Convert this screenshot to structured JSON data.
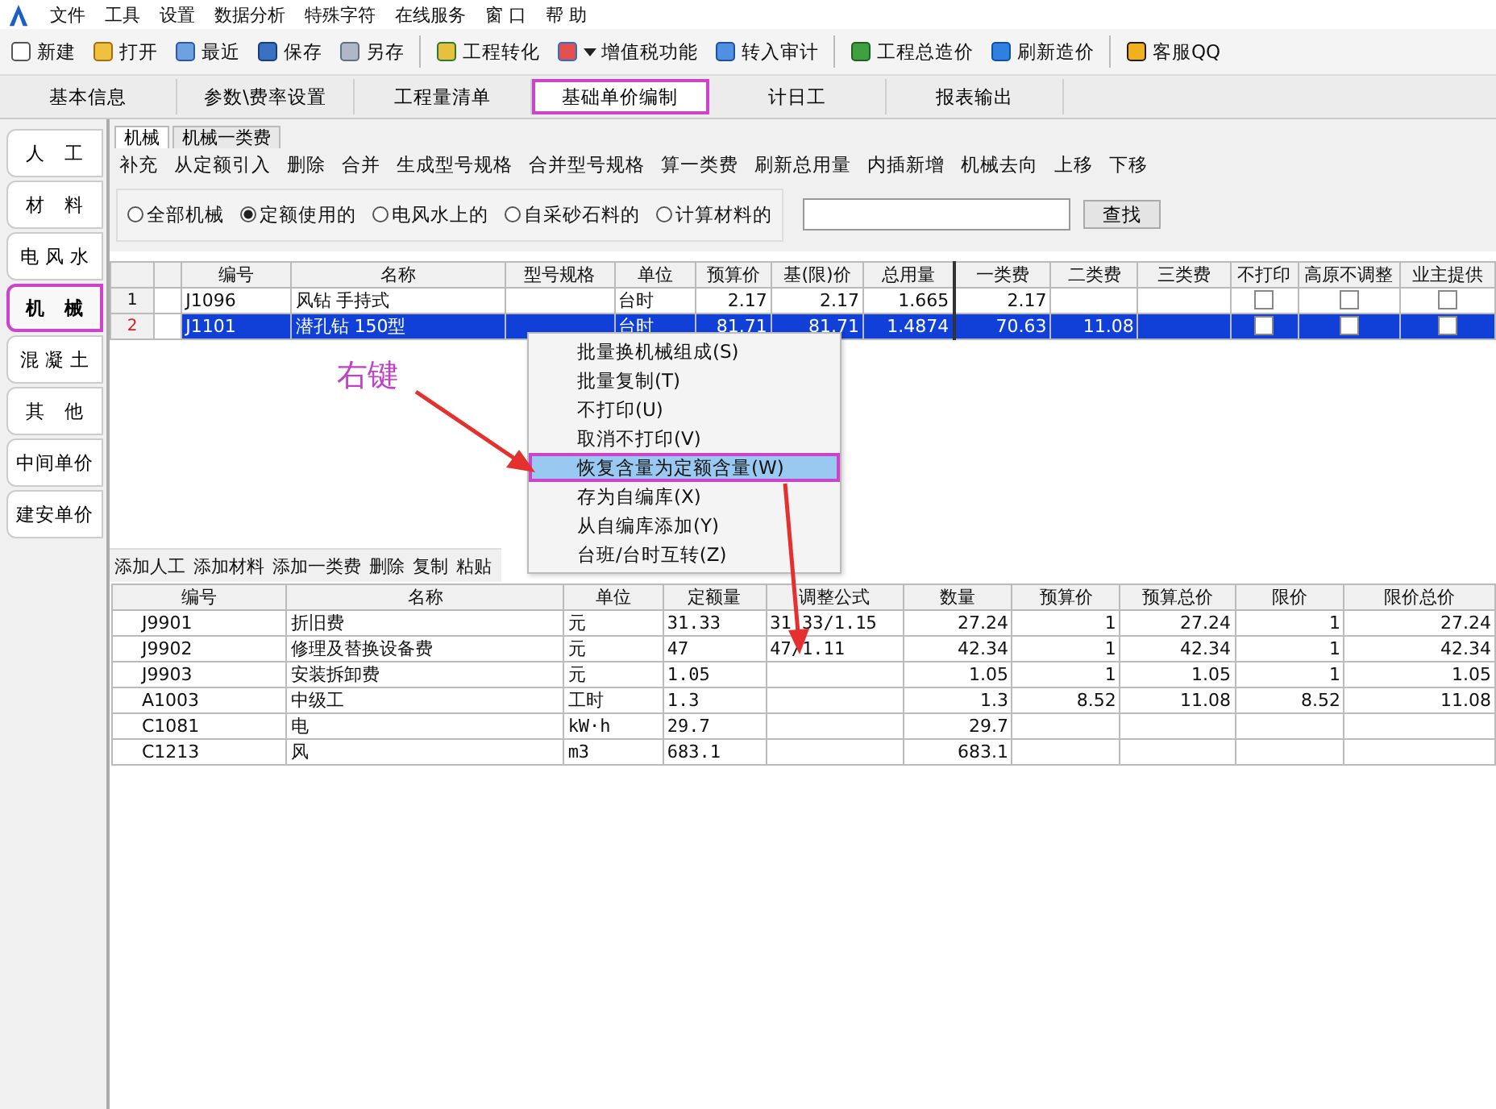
{
  "menu_bar": {
    "items": [
      "文件",
      "工具",
      "设置",
      "数据分析",
      "特殊字符",
      "在线服务",
      "窗 口",
      "帮 助"
    ]
  },
  "toolbar": {
    "groups": [
      [
        {
          "label": "新建"
        },
        {
          "label": "打开"
        },
        {
          "label": "最近"
        },
        {
          "label": "保存"
        },
        {
          "label": "另存"
        }
      ],
      [
        {
          "label": "工程转化"
        },
        {
          "label": "增值税功能",
          "dropdown": true
        },
        {
          "label": "转入审计"
        }
      ],
      [
        {
          "label": "工程总造价"
        },
        {
          "label": "刷新造价"
        }
      ],
      [
        {
          "label": "客服QQ"
        }
      ]
    ]
  },
  "main_tabs": [
    {
      "label": "基本信息",
      "selected": false,
      "highlighted": false
    },
    {
      "label": "参数\\费率设置",
      "selected": false,
      "highlighted": false
    },
    {
      "label": "工程量清单",
      "selected": false,
      "highlighted": false
    },
    {
      "label": "基础单价编制",
      "selected": true,
      "highlighted": true
    },
    {
      "label": "计日工",
      "selected": false,
      "highlighted": false
    },
    {
      "label": "报表输出",
      "selected": false,
      "highlighted": false
    }
  ],
  "side_tabs": [
    {
      "label": "人　工",
      "selected": false,
      "highlighted": false
    },
    {
      "label": "材　料",
      "selected": false,
      "highlighted": false
    },
    {
      "label": "电 风 水",
      "selected": false,
      "highlighted": false
    },
    {
      "label": "机　械",
      "selected": true,
      "highlighted": true
    },
    {
      "label": "混 凝 土",
      "selected": false,
      "highlighted": false
    },
    {
      "label": "其　他",
      "selected": false,
      "highlighted": false
    },
    {
      "label": "中间单价",
      "selected": false,
      "highlighted": false
    },
    {
      "label": "建安单价",
      "selected": false,
      "highlighted": false
    }
  ],
  "sub_tabs": [
    {
      "label": "机械",
      "selected": true
    },
    {
      "label": "机械一类费",
      "selected": false
    }
  ],
  "machine_toolbar": [
    "补充",
    "从定额引入",
    "删除",
    "合并",
    "生成型号规格",
    "合并型号规格",
    "算一类费",
    "刷新总用量",
    "内插新增",
    "机械去向",
    "上移",
    "下移"
  ],
  "filter": {
    "options": [
      {
        "label": "全部机械",
        "selected": false
      },
      {
        "label": "定额使用的",
        "selected": true
      },
      {
        "label": "电风水上的",
        "selected": false
      },
      {
        "label": "自采砂石料的",
        "selected": false
      },
      {
        "label": "计算材料的",
        "selected": false
      }
    ],
    "search_button": "查找"
  },
  "machine_table": {
    "columns": [
      "编号",
      "名称",
      "型号规格",
      "单位",
      "预算价",
      "基(限)价",
      "总用量",
      "一类费",
      "二类费",
      "三类费",
      "不打印",
      "高原不调整",
      "业主提供"
    ],
    "rows": [
      {
        "index": "1",
        "selected": false,
        "code": "J1096",
        "name": "风钻 手持式",
        "spec": "",
        "unit": "台时",
        "budget_price": "2.17",
        "base_price": "2.17",
        "total_usage": "1.665",
        "class1_fee": "2.17",
        "class2_fee": "",
        "class3_fee": "",
        "no_print": false,
        "plateau_no_adjust": false,
        "owner_supplied": false
      },
      {
        "index": "2",
        "selected": true,
        "code": "J1101",
        "name": "潜孔钻 150型",
        "spec": "",
        "unit": "台时",
        "budget_price": "81.71",
        "base_price": "81.71",
        "total_usage": "1.4874",
        "class1_fee": "70.63",
        "class2_fee": "11.08",
        "class3_fee": "",
        "no_print": false,
        "plateau_no_adjust": false,
        "owner_supplied": false
      }
    ]
  },
  "composition_toolbar": [
    "添加人工",
    "添加材料",
    "添加一类费",
    "删除",
    "复制",
    "粘贴"
  ],
  "composition_table": {
    "columns": [
      "编号",
      "名称",
      "单位",
      "定额量",
      "调整公式",
      "数量",
      "预算价",
      "预算总价",
      "限价",
      "限价总价"
    ],
    "rows": [
      {
        "code": "J9901",
        "name": "折旧费",
        "unit": "元",
        "quota": "31.33",
        "formula": "31.33/1.15",
        "quantity": "27.24",
        "budget_price": "1",
        "budget_total": "27.24",
        "limit_price": "1",
        "limit_total": "27.24"
      },
      {
        "code": "J9902",
        "name": "修理及替换设备费",
        "unit": "元",
        "quota": "47",
        "formula": "47/1.11",
        "quantity": "42.34",
        "budget_price": "1",
        "budget_total": "42.34",
        "limit_price": "1",
        "limit_total": "42.34"
      },
      {
        "code": "J9903",
        "name": "安装拆卸费",
        "unit": "元",
        "quota": "1.05",
        "formula": "",
        "quantity": "1.05",
        "budget_price": "1",
        "budget_total": "1.05",
        "limit_price": "1",
        "limit_total": "1.05"
      },
      {
        "code": "A1003",
        "name": "中级工",
        "unit": "工时",
        "quota": "1.3",
        "formula": "",
        "quantity": "1.3",
        "budget_price": "8.52",
        "budget_total": "11.08",
        "limit_price": "8.52",
        "limit_total": "11.08"
      },
      {
        "code": "C1081",
        "name": "电",
        "unit": "kW·h",
        "quota": "29.7",
        "formula": "",
        "quantity": "29.7",
        "budget_price": "",
        "budget_total": "",
        "limit_price": "",
        "limit_total": ""
      },
      {
        "code": "C1213",
        "name": "风",
        "unit": "m3",
        "quota": "683.1",
        "formula": "",
        "quantity": "683.1",
        "budget_price": "",
        "budget_total": "",
        "limit_price": "",
        "limit_total": ""
      }
    ]
  },
  "context_menu": {
    "items": [
      {
        "label": "批量换机械组成(S)",
        "selected": false,
        "highlighted": false
      },
      {
        "label": "批量复制(T)",
        "selected": false,
        "highlighted": false
      },
      {
        "label": "不打印(U)",
        "selected": false,
        "highlighted": false
      },
      {
        "label": "取消不打印(V)",
        "selected": false,
        "highlighted": false
      },
      {
        "label": "恢复含量为定额含量(W)",
        "selected": true,
        "highlighted": true
      },
      {
        "label": "存为自编库(X)",
        "selected": false,
        "highlighted": false
      },
      {
        "label": "从自编库添加(Y)",
        "selected": false,
        "highlighted": false
      },
      {
        "label": "台班/台时互转(Z)",
        "selected": false,
        "highlighted": false
      }
    ]
  },
  "annotation": {
    "label": "右键"
  }
}
